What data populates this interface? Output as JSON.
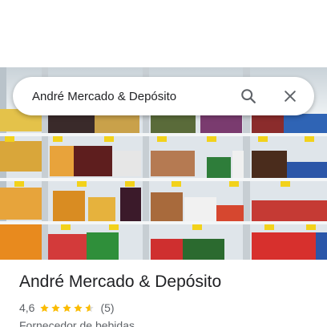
{
  "search": {
    "query": "André Mercado & Depósito",
    "search_icon": "search-icon",
    "close_icon": "close-icon"
  },
  "photo": {
    "subject": "store-photo",
    "shelf_price_tag_color": "#f2d21b"
  },
  "place": {
    "name": "André Mercado & Depósito",
    "rating": "4,6",
    "rating_value": 4.6,
    "stars_max": 5,
    "review_count": "(5)",
    "category": "Fornecedor de bebidas"
  },
  "colors": {
    "star": "#fbbc04",
    "star_empty": "#dadce0",
    "text_primary": "#202124",
    "text_secondary": "#5f6368",
    "icon": "#5f6368"
  }
}
